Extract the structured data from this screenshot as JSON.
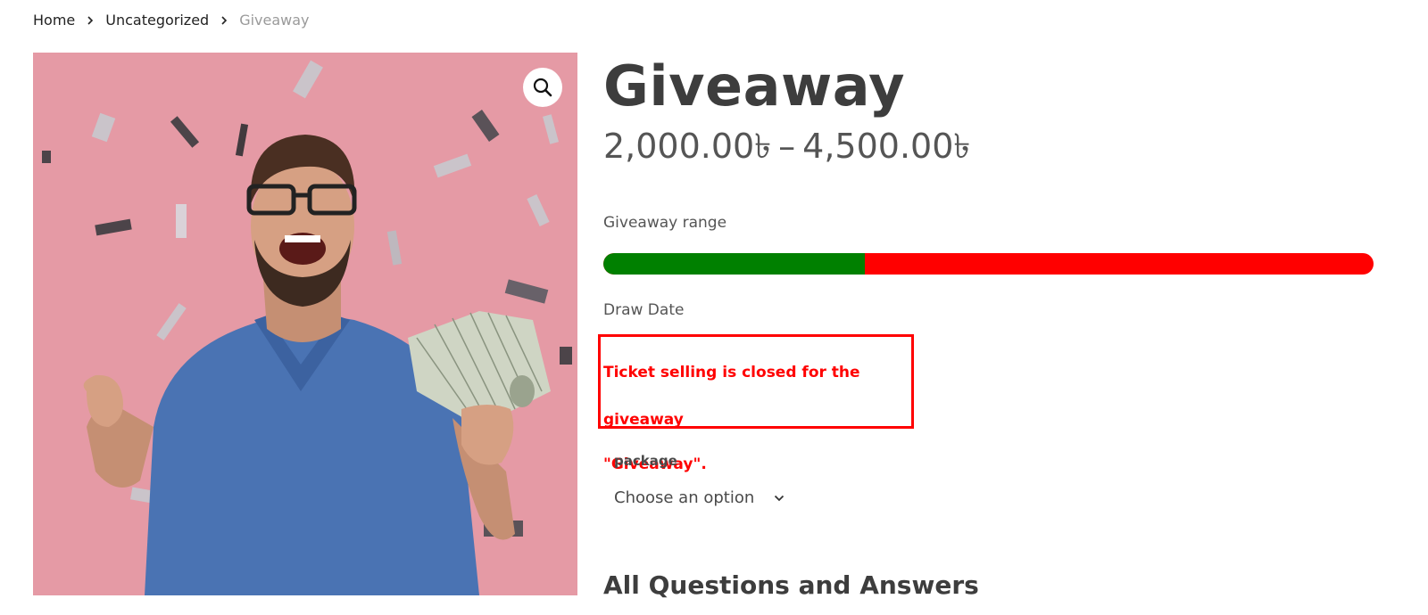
{
  "breadcrumb": {
    "home": "Home",
    "category": "Uncategorized",
    "current": "Giveaway"
  },
  "product": {
    "title": "Giveaway",
    "price_min": "2,000.00৳",
    "price_sep": "–",
    "price_max": "4,500.00৳",
    "image_zoom_icon": "magnifier-icon"
  },
  "range": {
    "label": "Giveaway range",
    "progress_fraction": 0.34,
    "fill_color": "#008000",
    "track_color": "#ff0000"
  },
  "draw": {
    "label": "Draw Date",
    "closed_line1": "Ticket selling is closed for the giveaway",
    "closed_line2": "\"Giveaway\".",
    "alert_color": "#ff0000"
  },
  "package": {
    "label": "package",
    "selected": "Choose an option"
  },
  "qa": {
    "heading": "All Questions and Answers"
  }
}
